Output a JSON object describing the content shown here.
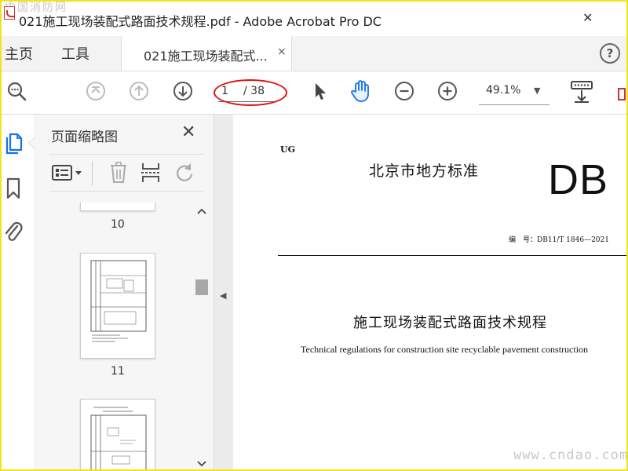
{
  "window": {
    "title": "021施工现场装配式路面技术规程.pdf - Adobe Acrobat Pro DC",
    "close_glyph": "✕"
  },
  "watermarks": {
    "top_left": "中国消防网",
    "bottom_right": "www.cndao.com"
  },
  "tabs": {
    "home": "主页",
    "tools": "工具",
    "document": "021施工现场装配式...",
    "document_close": "×"
  },
  "toolbar": {
    "current_page": "1",
    "total_pages": "/ 38",
    "zoom": "49.1%"
  },
  "thumbnails": {
    "title": "页面缩略图",
    "close": "✕",
    "pages": [
      {
        "label": "10"
      },
      {
        "label": "11"
      }
    ]
  },
  "document": {
    "corner_tag": "UG",
    "issuer": "北京市地方标准",
    "standard_prefix": "DB",
    "code_line": "编　号：DB11/T 1846—2021",
    "title_cn": "施工现场装配式路面技术规程",
    "title_en": "Technical regulations for construction site recyclable pavement construction"
  },
  "colors": {
    "highlight_ellipse": "#e01010",
    "frame_border": "#f2e31a",
    "active_hand_icon": "#1473e6"
  }
}
